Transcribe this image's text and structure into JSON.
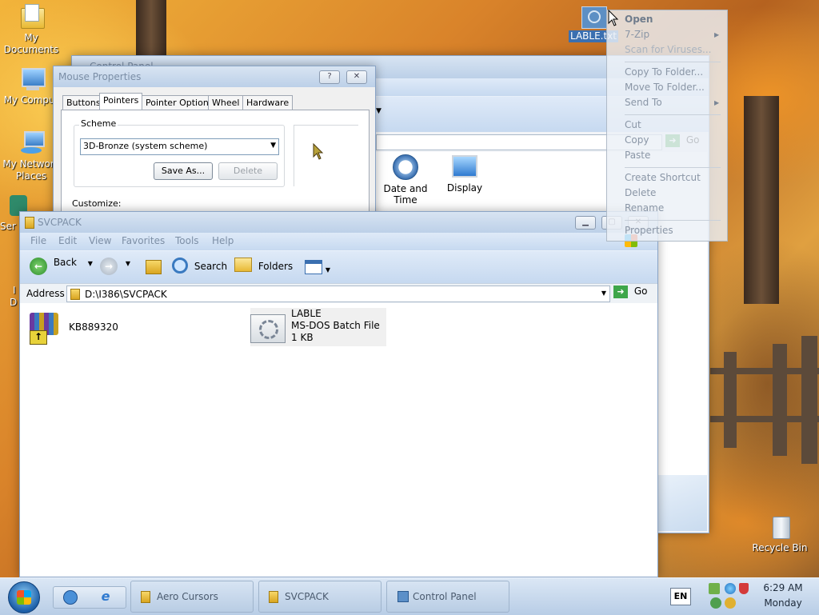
{
  "desktop": {
    "icons": [
      {
        "label_1": "My",
        "label_2": "Documents"
      },
      {
        "label_1": "My Comput"
      },
      {
        "label_1": "My Network",
        "label_2": "Places"
      },
      {
        "label_1": "Ser"
      },
      {
        "label_1": "I",
        "label_2": "D"
      },
      {
        "label_1": "LABLE.txt"
      },
      {
        "label_1": "Recycle Bin"
      }
    ]
  },
  "control_panel_window": {
    "title": "Control Panel",
    "items": [
      {
        "label_1": "Date and",
        "label_2": "Time"
      },
      {
        "label_1": "Display"
      }
    ],
    "go_label": "Go"
  },
  "mouse_properties": {
    "title": "Mouse Properties",
    "help_glyph": "?",
    "close_glyph": "✕",
    "tabs": [
      "Buttons",
      "Pointers",
      "Pointer Options",
      "Wheel",
      "Hardware"
    ],
    "scheme_label": "Scheme",
    "scheme_value": "3D-Bronze (system scheme)",
    "save_as_label": "Save As...",
    "delete_label": "Delete",
    "customize_label": "Customize:"
  },
  "svcpack_window": {
    "title": "SVCPACK",
    "menu": [
      "File",
      "Edit",
      "View",
      "Favorites",
      "Tools",
      "Help"
    ],
    "toolbar": {
      "back": "Back",
      "search": "Search",
      "folders": "Folders"
    },
    "address_label": "Address",
    "address_value": "D:\\I386\\SVCPACK",
    "go_label": "Go",
    "files": [
      {
        "name": "KB889320"
      },
      {
        "name": "LABLE",
        "type": "MS-DOS Batch File",
        "size": "1 KB"
      }
    ]
  },
  "context_menu": {
    "items": [
      {
        "label": "Open",
        "bold": true
      },
      {
        "label": "7-Zip",
        "submenu": true
      },
      {
        "label": "Scan for Viruses..."
      },
      {
        "label": "Copy To Folder..."
      },
      {
        "label": "Move To Folder..."
      },
      {
        "label": "Send To",
        "submenu": true
      },
      {
        "label": "Cut"
      },
      {
        "label": "Copy"
      },
      {
        "label": "Paste"
      },
      {
        "label": "Create Shortcut"
      },
      {
        "label": "Delete"
      },
      {
        "label": "Rename"
      },
      {
        "label": "Properties"
      }
    ]
  },
  "taskbar": {
    "tasks": [
      "Aero Cursors",
      "SVCPACK",
      "Control Panel"
    ],
    "language": "EN",
    "time": "6:29 AM",
    "day": "Monday"
  },
  "colors": {
    "taskbar": "#c5d7ec",
    "title_glass": "#c9d9ee",
    "go_green": "#3ea64a"
  }
}
